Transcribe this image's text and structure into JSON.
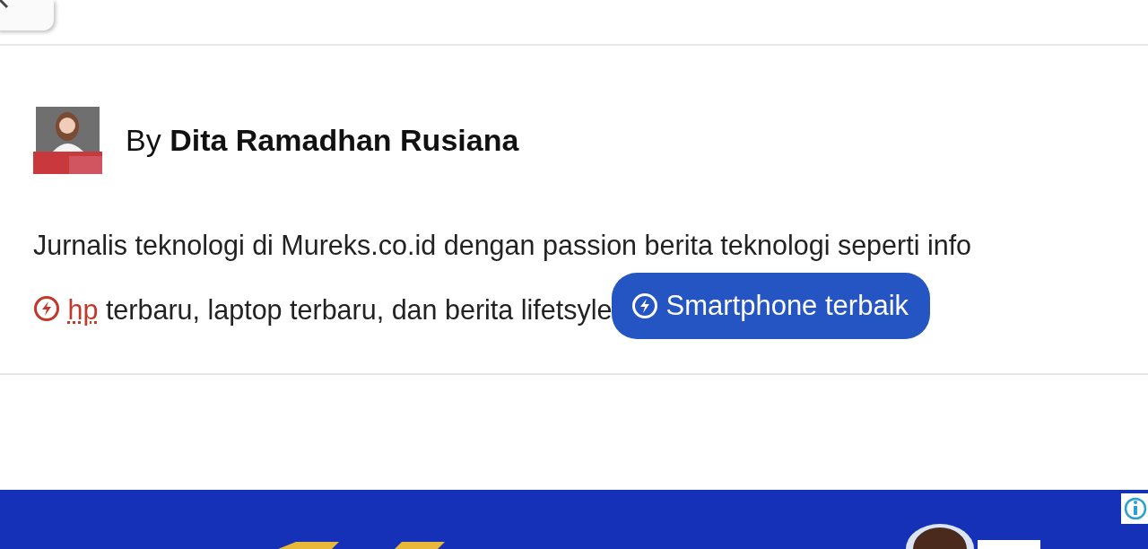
{
  "author": {
    "prefix": "By",
    "name": "Dita Ramadhan Rusiana"
  },
  "bio": {
    "text_start": "Jurnalis teknologi di Mureks.co.id dengan passion berita teknologi seperti info",
    "link": "hp",
    "text_end": " terbaru, laptop terbaru, dan berita lifetsyle",
    "chip": "Smartphone terbaik"
  }
}
